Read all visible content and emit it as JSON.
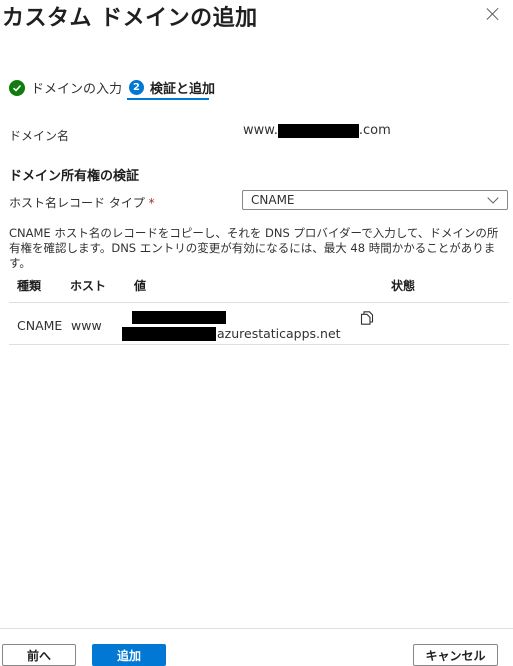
{
  "dialog": {
    "title": "カスタム ドメインの追加",
    "close_label": "×"
  },
  "steps": [
    {
      "label": "ドメインの入力",
      "status": "complete"
    },
    {
      "label": "検証と追加",
      "number": "2",
      "status": "active"
    }
  ],
  "domain": {
    "label": "ドメイン名",
    "prefix": "www.",
    "suffix": ".com"
  },
  "verify": {
    "section_title": "ドメイン所有権の検証",
    "record_type_label": "ホスト名レコード タイプ",
    "required_mark": "*",
    "record_type_value": "CNAME",
    "description": "CNAME ホスト名のレコードをコピーし、それを DNS プロバイダーで入力して、ドメインの所有権を確認します。DNS エントリの変更が有効になるには、最大 48 時間かかることがあります。"
  },
  "table": {
    "headers": {
      "type": "種類",
      "host": "ホスト",
      "value": "値",
      "status": "状態"
    },
    "rows": [
      {
        "type": "CNAME",
        "host": "www",
        "value_suffix": "azurestaticapps.net"
      }
    ]
  },
  "footer": {
    "prev_label": "前へ",
    "add_label": "追加",
    "cancel_label": "キャンセル"
  },
  "colors": {
    "accent": "#0078d4",
    "success": "#107c10",
    "redaction": "#000000"
  }
}
